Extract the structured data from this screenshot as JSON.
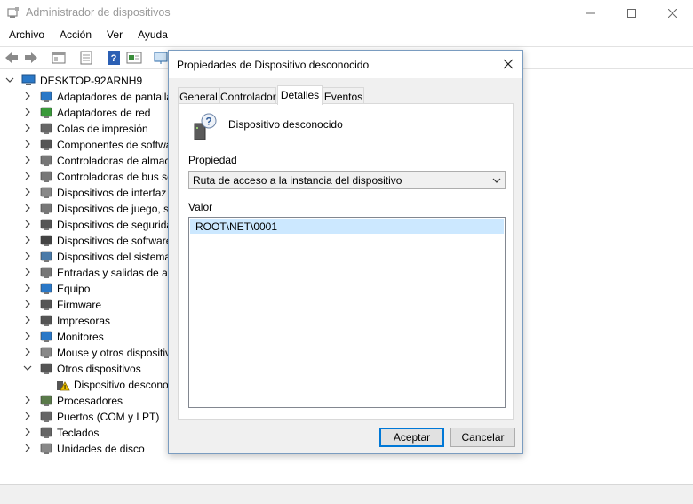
{
  "window": {
    "title": "Administrador de dispositivos",
    "icon": "device-manager-icon"
  },
  "menu": [
    {
      "label": "Archivo"
    },
    {
      "label": "Acción"
    },
    {
      "label": "Ver"
    },
    {
      "label": "Ayuda"
    }
  ],
  "toolbar": [
    "back-arrow-icon",
    "forward-arrow-icon",
    "properties-view-icon",
    "properties-sheet-icon",
    "help-icon",
    "action-view-icon",
    "monitor-scan-icon"
  ],
  "tree": {
    "root": "DESKTOP-92ARNH9",
    "items": [
      {
        "label": "Adaptadores de pantalla",
        "icon": "display-adapter-icon",
        "expanded": false
      },
      {
        "label": "Adaptadores de red",
        "icon": "network-adapter-icon",
        "expanded": false
      },
      {
        "label": "Colas de impresión",
        "icon": "print-queue-icon",
        "expanded": false
      },
      {
        "label": "Componentes de software",
        "icon": "software-component-icon",
        "expanded": false
      },
      {
        "label": "Controladoras de almacenamiento",
        "icon": "storage-controller-icon",
        "expanded": false
      },
      {
        "label": "Controladoras de bus serie",
        "icon": "usb-controller-icon",
        "expanded": false
      },
      {
        "label": "Dispositivos de interfaz",
        "icon": "hid-icon",
        "expanded": false
      },
      {
        "label": "Dispositivos de juego, sonido",
        "icon": "sound-icon",
        "expanded": false
      },
      {
        "label": "Dispositivos de seguridad",
        "icon": "security-device-icon",
        "expanded": false
      },
      {
        "label": "Dispositivos de software",
        "icon": "software-device-icon",
        "expanded": false
      },
      {
        "label": "Dispositivos del sistema",
        "icon": "system-device-icon",
        "expanded": false
      },
      {
        "label": "Entradas y salidas de audio",
        "icon": "audio-io-icon",
        "expanded": false
      },
      {
        "label": "Equipo",
        "icon": "computer-icon",
        "expanded": false
      },
      {
        "label": "Firmware",
        "icon": "firmware-icon",
        "expanded": false
      },
      {
        "label": "Impresoras",
        "icon": "printer-icon",
        "expanded": false
      },
      {
        "label": "Monitores",
        "icon": "monitor-icon",
        "expanded": false
      },
      {
        "label": "Mouse y otros dispositivos",
        "icon": "mouse-icon",
        "expanded": false
      },
      {
        "label": "Otros dispositivos",
        "icon": "other-devices-icon",
        "expanded": true
      },
      {
        "label": "Dispositivo desconocido",
        "icon": "unknown-device-warning-icon",
        "child": true
      },
      {
        "label": "Procesadores",
        "icon": "processor-icon",
        "expanded": false
      },
      {
        "label": "Puertos (COM y LPT)",
        "icon": "port-icon",
        "expanded": false
      },
      {
        "label": "Teclados",
        "icon": "keyboard-icon",
        "expanded": false
      },
      {
        "label": "Unidades de disco",
        "icon": "disk-drive-icon",
        "expanded": false
      }
    ]
  },
  "dialog": {
    "title": "Propiedades de Dispositivo desconocido",
    "tabs": [
      {
        "label": "General",
        "active": false
      },
      {
        "label": "Controlador",
        "active": false
      },
      {
        "label": "Detalles",
        "active": true
      },
      {
        "label": "Eventos",
        "active": false
      }
    ],
    "device_name": "Dispositivo desconocido",
    "property_label": "Propiedad",
    "property_selected": "Ruta de acceso a la instancia del dispositivo",
    "value_label": "Valor",
    "values": [
      "ROOT\\NET\\0001"
    ],
    "ok_label": "Aceptar",
    "cancel_label": "Cancelar"
  },
  "colors": {
    "accent": "#0078d7",
    "selection": "#cce8ff",
    "dialog_bg": "#f0f0f0"
  }
}
